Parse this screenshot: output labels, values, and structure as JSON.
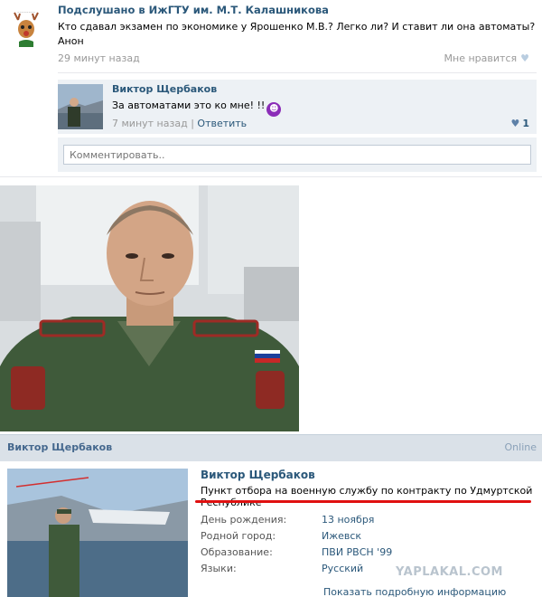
{
  "post": {
    "author": "Подслушано в ИжГТУ им. М.Т. Калашникова",
    "text_line1": "Кто сдавал экзамен по экономике у Ярошенко М.В.? Легко ли? И ставит ли она автоматы?",
    "text_line2": "Анон",
    "time": "29 минут назад",
    "like_label": "Мне нравится",
    "avatar_icon": "deer-logo-icon"
  },
  "reply": {
    "author": "Виктор Щербаков",
    "text": "За автоматами это ко мне! !!",
    "emoji_icon": "devil-emoji-icon",
    "time": "7 минут назад",
    "separator": "|",
    "answer_label": "Ответить",
    "likes": "1"
  },
  "comment": {
    "placeholder": "Комментировать.."
  },
  "profile": {
    "header_name": "Виктор Щербаков",
    "online": "Online",
    "name": "Виктор Щербаков",
    "status": "Пункт отбора на военную службу по контракту по Удмуртской Республике",
    "rows": [
      {
        "label": "День рождения:",
        "value": "13 ноября"
      },
      {
        "label": "Родной город:",
        "value": "Ижевск"
      },
      {
        "label": "Образование:",
        "value": "ПВИ РВСН '99"
      },
      {
        "label": "Языки:",
        "value": "Русский"
      }
    ],
    "more_info": "Показать подробную информацию"
  },
  "watermark": "YAPLAKAL.COM",
  "colors": {
    "link": "#2b587a",
    "header_bg": "#dae1e8",
    "reply_bg": "#edf1f5",
    "underline": "#e01010"
  }
}
